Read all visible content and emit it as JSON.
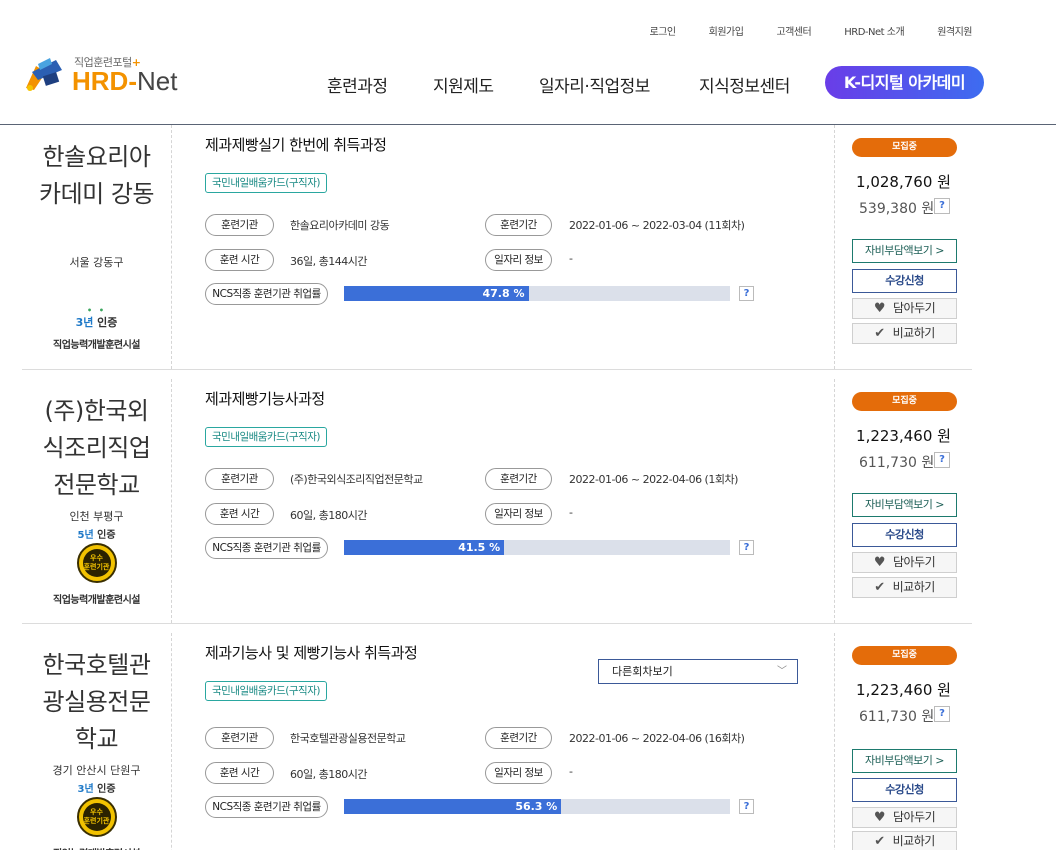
{
  "header": {
    "util_links": [
      "로그인",
      "회원가입",
      "고객센터",
      "HRD-Net 소개",
      "원격지원"
    ],
    "logo": {
      "sub": "직업훈련포털",
      "plus": "+",
      "hrd": "HRD",
      "dash": "-",
      "net": "Net"
    },
    "nav": [
      "훈련과정",
      "지원제도",
      "일자리·직업정보",
      "지식정보센터"
    ],
    "nav_special": "K-디지털 아카데미"
  },
  "labels": {
    "org": "훈련기관",
    "period": "훈련기간",
    "hours": "훈련 시간",
    "job": "일자리 정보",
    "ncs": "NCS직종 훈련기관 취업률",
    "q": "?",
    "select_default": "다른회차보기",
    "status": "모집중",
    "self_pay": "자비부담액보기 >",
    "apply": "수강신청",
    "wish": "담아두기",
    "compare": "비교하기",
    "won": "원",
    "cert_prefix": "년",
    "cert_suffix": " 인증",
    "excellent": "우수\n훈련기관",
    "facility": "직업능력개발훈련시설"
  },
  "courses": [
    {
      "org_name_lines": [
        "한솔요리아",
        "카데미 강동"
      ],
      "region": "서울 강동구",
      "cert_years": "3",
      "excellent": false,
      "title": "제과제빵실기 한번에 취득과정",
      "card": "국민내일배움카드(구직자)",
      "org": "한솔요리아카데미 강동",
      "period": "2022-01-06 ~ 2022-03-04 (11회차)",
      "hours": "36일, 총144시간",
      "job": "-",
      "employment_rate": "47.8 %",
      "employment_pct": 47.8,
      "price": "1,028,760 원",
      "self_price": "539,380 원",
      "has_select": false
    },
    {
      "org_name_lines": [
        "(주)한국외",
        "식조리직업",
        "전문학교"
      ],
      "region": "인천 부평구",
      "cert_years": "5",
      "excellent": true,
      "title": "제과제빵기능사과정",
      "card": "국민내일배움카드(구직자)",
      "org": "(주)한국외식조리직업전문학교",
      "period": "2022-01-06 ~ 2022-04-06 (1회차)",
      "hours": "60일, 총180시간",
      "job": "-",
      "employment_rate": "41.5 %",
      "employment_pct": 41.5,
      "price": "1,223,460 원",
      "self_price": "611,730 원",
      "has_select": false
    },
    {
      "org_name_lines": [
        "한국호텔관",
        "광실용전문",
        "학교"
      ],
      "region": "경기 안산시 단원구",
      "cert_years": "3",
      "excellent": true,
      "title": "제과기능사 및 제빵기능사 취득과정",
      "card": "국민내일배움카드(구직자)",
      "org": "한국호텔관광실용전문학교",
      "period": "2022-01-06 ~ 2022-04-06 (16회차)",
      "hours": "60일, 총180시간",
      "job": "-",
      "employment_rate": "56.3 %",
      "employment_pct": 56.3,
      "price": "1,223,460 원",
      "self_price": "611,730 원",
      "has_select": true
    }
  ]
}
